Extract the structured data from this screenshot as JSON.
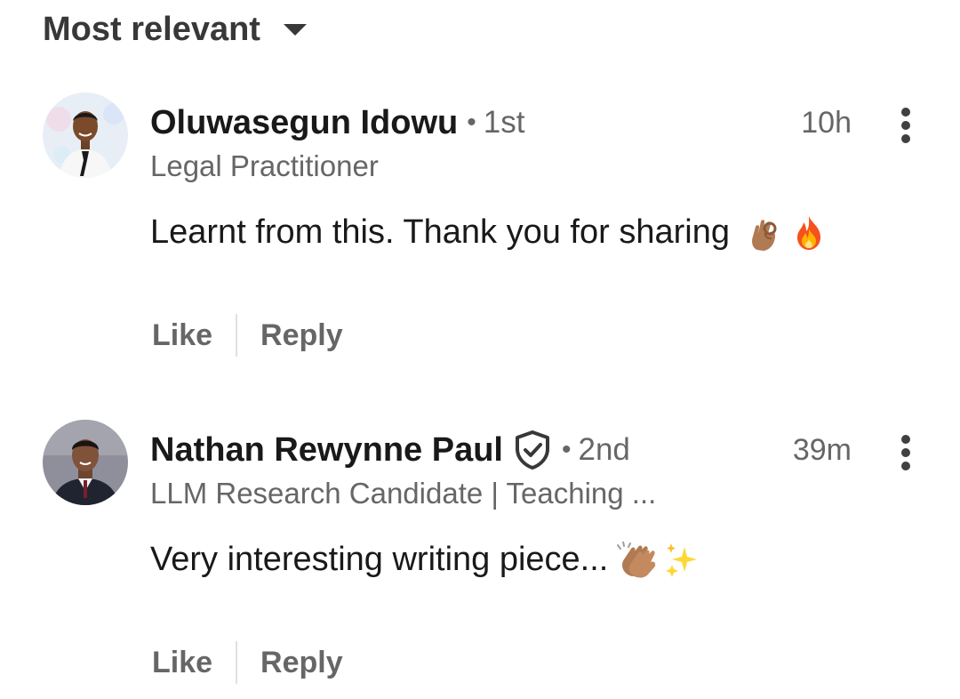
{
  "sort": {
    "label": "Most relevant",
    "icon": "caret-down-icon"
  },
  "comments": [
    {
      "author": "Oluwasegun Idowu",
      "separator": "•",
      "degree": "1st",
      "headline": "Legal Practitioner",
      "time": "10h",
      "text": "Learnt from this. Thank you for sharing",
      "emojis": [
        "ok-hand-icon",
        "fire-icon"
      ],
      "verified": false,
      "actions": {
        "like": "Like",
        "reply": "Reply"
      }
    },
    {
      "author": "Nathan Rewynne Paul",
      "separator": "•",
      "degree": "2nd",
      "headline": "LLM Research Candidate | Teaching ...",
      "time": "39m",
      "text": "Very interesting writing piece...",
      "emojis": [
        "clapping-hands-icon",
        "sparkles-icon"
      ],
      "verified": true,
      "actions": {
        "like": "Like",
        "reply": "Reply"
      }
    }
  ],
  "colors": {
    "primary_text": "#191919",
    "secondary_text": "#666666",
    "icon": "#404040",
    "divider": "#e0e0e0"
  }
}
